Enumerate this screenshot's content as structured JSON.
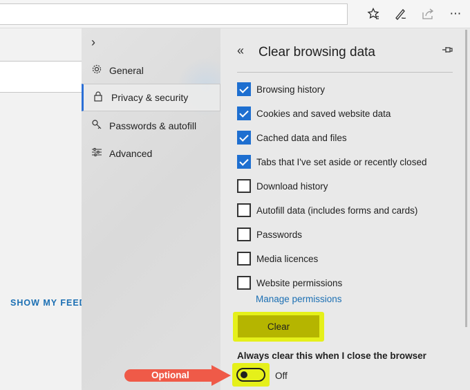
{
  "toolbar": {
    "favorites_icon": "favorites-star-icon",
    "notes_icon": "pen-icon",
    "share_icon": "share-icon",
    "more_icon": "more-ellipsis-icon",
    "more_glyph": "⋯"
  },
  "page": {
    "show_feed": "SHOW MY FEED"
  },
  "nav": {
    "expand_glyph": "›",
    "items": [
      {
        "label": "General",
        "icon": "gear-icon"
      },
      {
        "label": "Privacy & security",
        "icon": "lock-icon",
        "active": true
      },
      {
        "label": "Passwords & autofill",
        "icon": "key-icon"
      },
      {
        "label": "Advanced",
        "icon": "sliders-icon"
      }
    ]
  },
  "pane": {
    "back_glyph": "«",
    "title": "Clear browsing data",
    "pin_icon": "pin-icon",
    "options": [
      {
        "label": "Browsing history",
        "checked": true
      },
      {
        "label": "Cookies and saved website data",
        "checked": true
      },
      {
        "label": "Cached data and files",
        "checked": true
      },
      {
        "label": "Tabs that I've set aside or recently closed",
        "checked": true
      },
      {
        "label": "Download history",
        "checked": false
      },
      {
        "label": "Autofill data (includes forms and cards)",
        "checked": false
      },
      {
        "label": "Passwords",
        "checked": false
      },
      {
        "label": "Media licences",
        "checked": false
      },
      {
        "label": "Website permissions",
        "checked": false
      }
    ],
    "manage_link": "Manage permissions",
    "clear_button": "Clear",
    "always_clear_label": "Always clear this when I close the browser",
    "toggle_state": "Off"
  },
  "annotation": {
    "label": "Optional"
  },
  "colors": {
    "accent": "#1e6fd0",
    "highlight": "#e5f01a",
    "clear_button": "#b5b500",
    "arrow": "#ef5a48",
    "link": "#1b6fb3"
  }
}
